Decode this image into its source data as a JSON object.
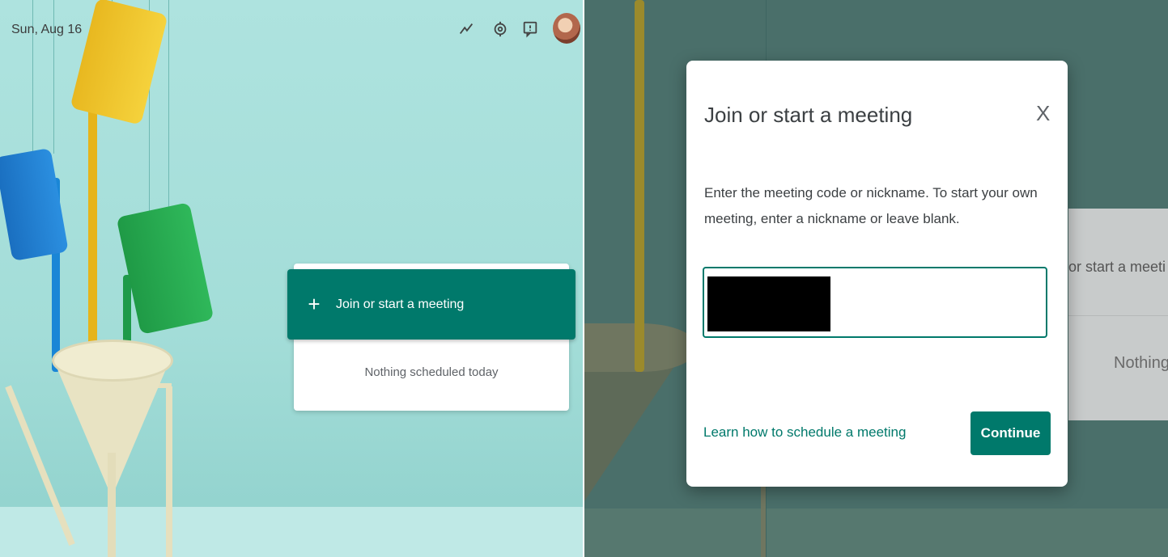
{
  "left": {
    "date": "Sun, Aug 16",
    "icons": [
      "activity-icon",
      "settings-icon",
      "feedback-icon",
      "avatar"
    ],
    "join_button_label": "Join or start a meeting",
    "join_button_icon": "+",
    "nothing_scheduled": "Nothing scheduled today"
  },
  "right_background": {
    "card_title_partial": "or start a meeti",
    "card_text_partial": "Nothing"
  },
  "dialog": {
    "title": "Join or start a meeting",
    "close_glyph": "X",
    "description": "Enter the meeting code or nickname. To start your own meeting, enter a nickname or leave blank.",
    "learn_link": "Learn how to schedule a meeting",
    "continue_label": "Continue"
  },
  "colors": {
    "accent": "#00796b",
    "background": "#a9e0dc"
  }
}
